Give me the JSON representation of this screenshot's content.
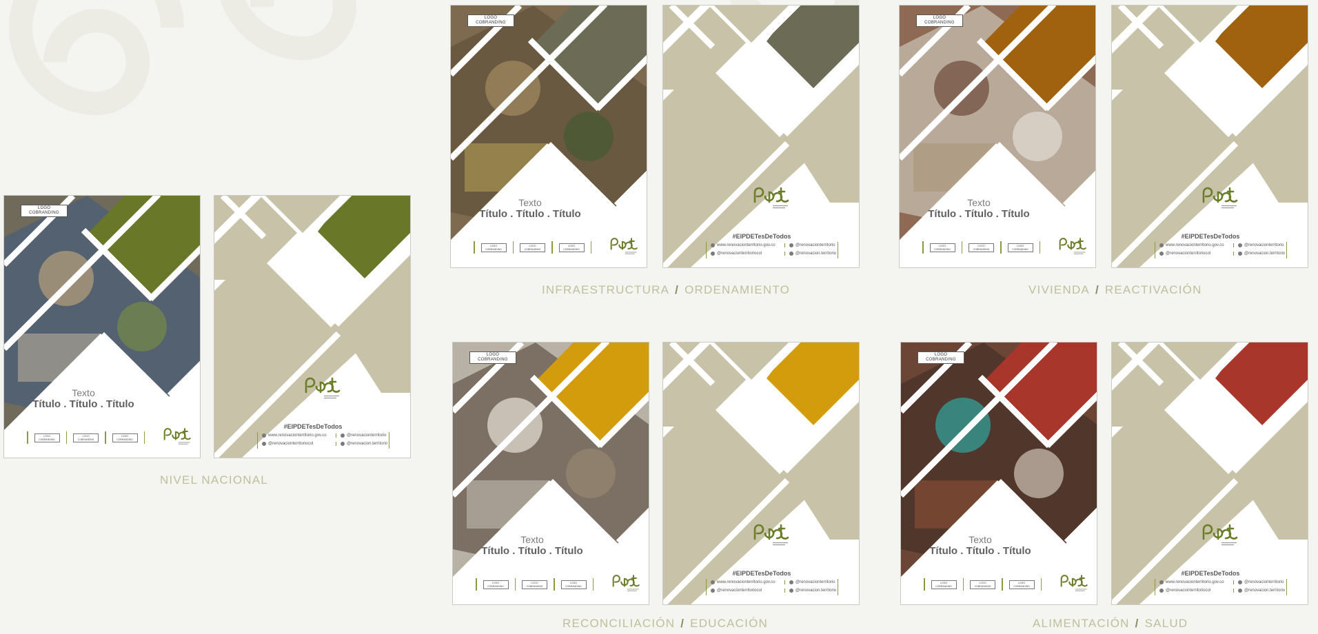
{
  "colors": {
    "beige": "#c8c2a8",
    "nacional": "#687728",
    "infraestructura": "#6c6b55",
    "vivienda": "#a1620f",
    "reconciliacion": "#d29c0c",
    "alimentacion": "#a8362a",
    "line_green": "#8a9a3e"
  },
  "cover": {
    "logo_line1": "LOGO",
    "logo_line2": "COBRANDING",
    "title_small": "Texto",
    "title_main": "Título . Título . Título",
    "mini_logo_line1": "LOGO",
    "mini_logo_line2": "COBRANDING"
  },
  "back": {
    "hashtag": "#ElPDETesDeTodos",
    "web": "www.renovacionterritorio.gov.co",
    "facebook": "@renovacionterritoriocol",
    "twitter": "@renovacionterritorio",
    "instagram": "@renovacion.territorio"
  },
  "groups": [
    {
      "id": "nacional",
      "caption_a": "NIVEL NACIONAL",
      "caption_b": "",
      "photo": "people-group-photo"
    },
    {
      "id": "infraestructura",
      "caption_a": "INFRAESTRUCTURA",
      "caption_b": "ORDENAMIENTO",
      "photo": "construction-worker-photo"
    },
    {
      "id": "vivienda",
      "caption_a": "VIVIENDA",
      "caption_b": "REACTIVACIÓN",
      "photo": "farmer-photo"
    },
    {
      "id": "reconciliacion",
      "caption_a": "RECONCILIACIÓN",
      "caption_b": "EDUCACIÓN",
      "photo": "schoolgirl-photo"
    },
    {
      "id": "alimentacion",
      "caption_a": "ALIMENTACIÓN",
      "caption_b": "SALUD",
      "photo": "child-photo"
    }
  ],
  "icons": [
    "globe-icon",
    "facebook-icon",
    "twitter-icon",
    "instagram-icon",
    "pdet-logo"
  ]
}
